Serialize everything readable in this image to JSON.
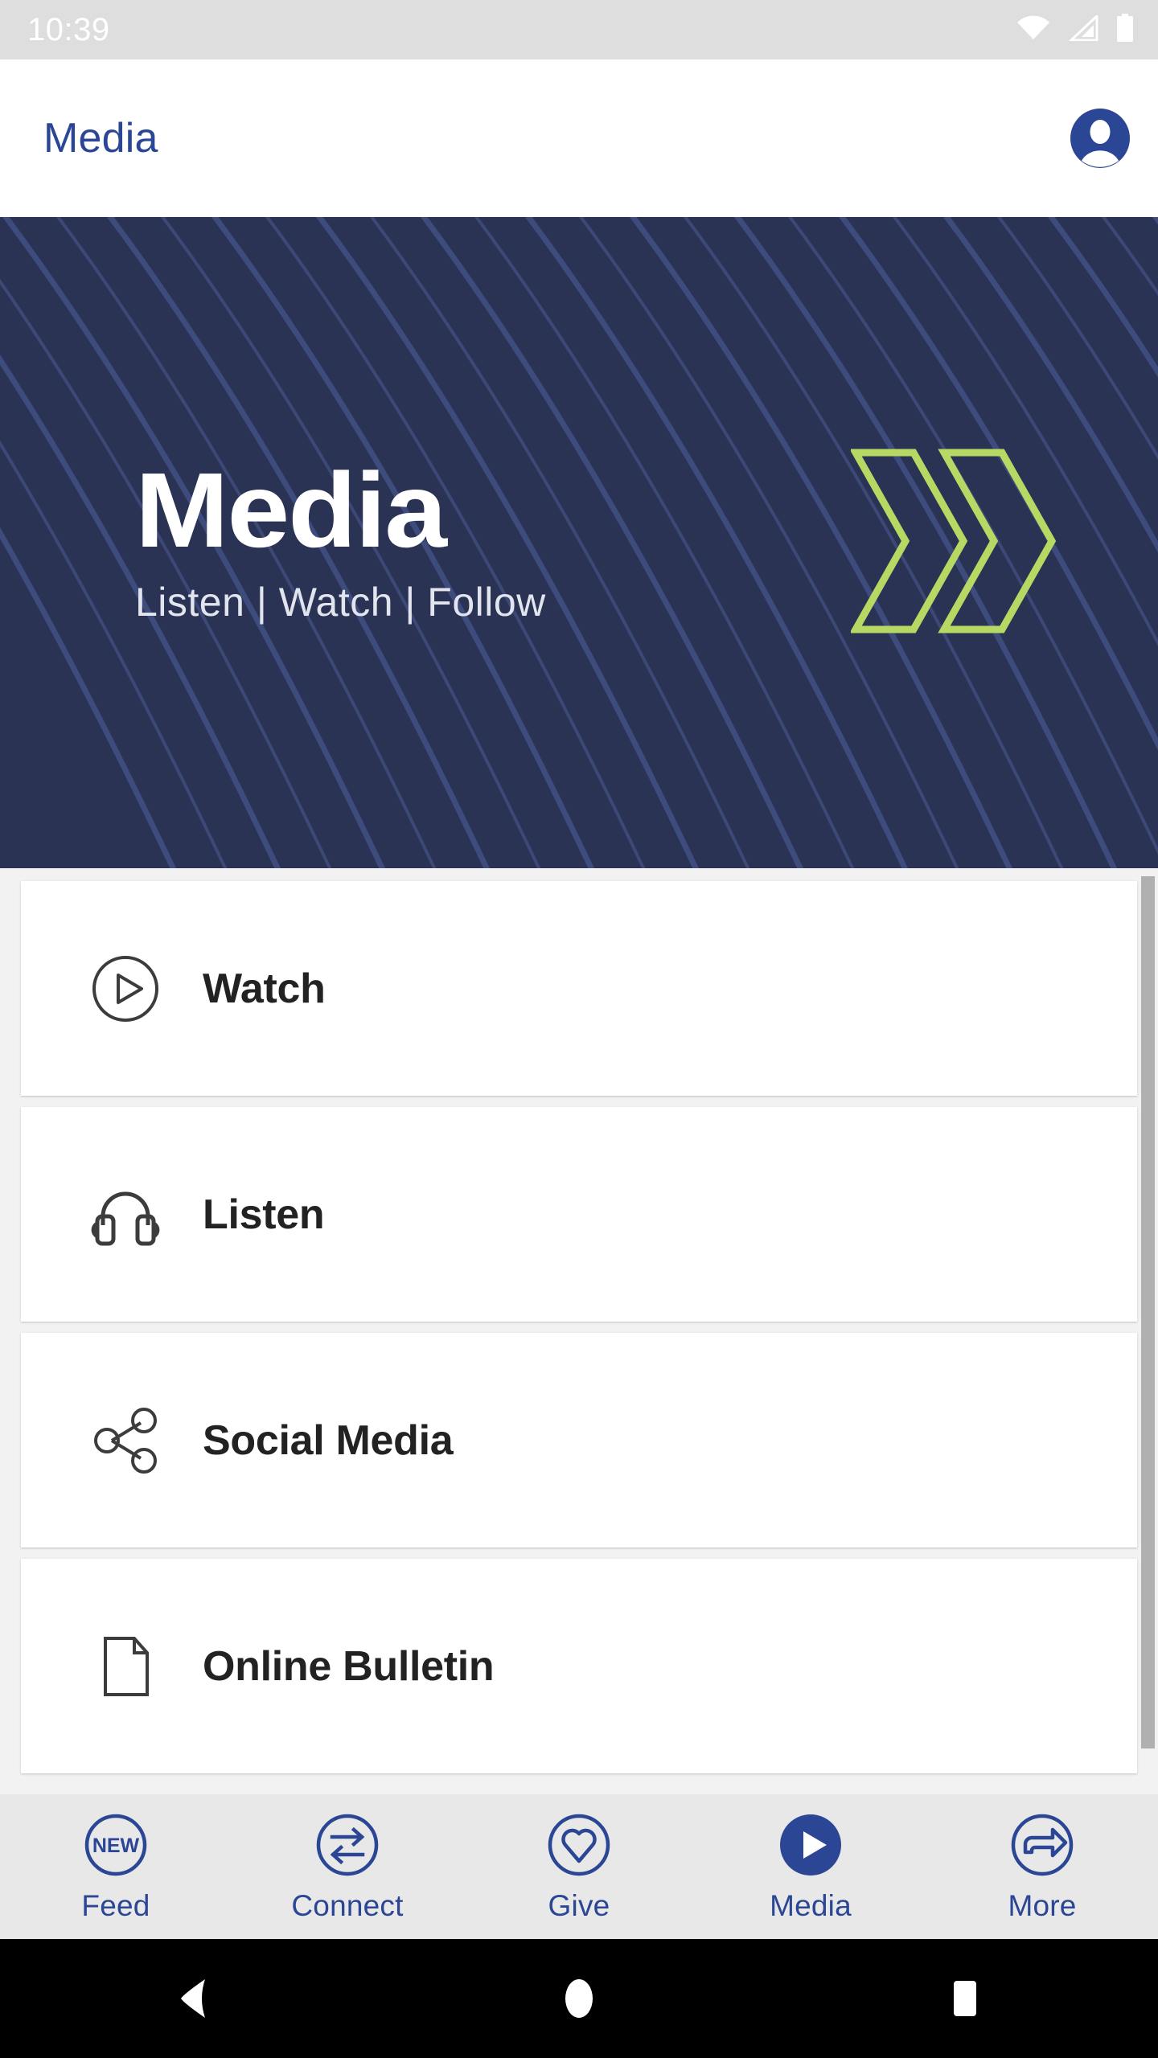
{
  "status_bar": {
    "time": "10:39",
    "icons": [
      "wifi-icon",
      "cellular-signal-icon",
      "battery-icon"
    ],
    "background": "#dedede",
    "foreground": "#ffffff"
  },
  "app_bar": {
    "title": "Media",
    "title_color": "#2a4694",
    "avatar_icon": "account-circle-icon",
    "background": "#ffffff"
  },
  "hero": {
    "title": "Media",
    "subtitle": "Listen | Watch | Follow",
    "background_color": "#2b3355",
    "stripe_color": "#3e4d80",
    "chevron_color": "#b7d863",
    "chevron_icon": "double-chevron-right-icon"
  },
  "menu": {
    "items": [
      {
        "label": "Watch",
        "icon": "play-circle-outline-icon"
      },
      {
        "label": "Listen",
        "icon": "headphones-icon"
      },
      {
        "label": "Social Media",
        "icon": "share-nodes-icon"
      },
      {
        "label": "Online Bulletin",
        "icon": "document-page-icon"
      }
    ],
    "card_background": "#ffffff",
    "label_color": "#222222",
    "page_background": "#f2f2f2"
  },
  "scrollbar": {
    "thumb_color": "#b0b0b0",
    "visible": true
  },
  "bottom_nav": {
    "background": "#e8e8e8",
    "accent_color": "#2a4694",
    "active_index": 3,
    "items": [
      {
        "label": "Feed",
        "icon": "new-badge-circle-icon",
        "badge_text": "NEW",
        "active": false
      },
      {
        "label": "Connect",
        "icon": "two-way-arrows-circle-icon",
        "active": false
      },
      {
        "label": "Give",
        "icon": "heart-circle-icon",
        "active": false
      },
      {
        "label": "Media",
        "icon": "play-filled-circle-icon",
        "active": true
      },
      {
        "label": "More",
        "icon": "arrow-forward-circle-icon",
        "active": false
      }
    ]
  },
  "android_nav": {
    "background": "#000000",
    "buttons": [
      {
        "name": "back-button",
        "icon": "triangle-left-icon"
      },
      {
        "name": "home-button",
        "icon": "circle-icon"
      },
      {
        "name": "recents-button",
        "icon": "square-icon"
      }
    ]
  }
}
